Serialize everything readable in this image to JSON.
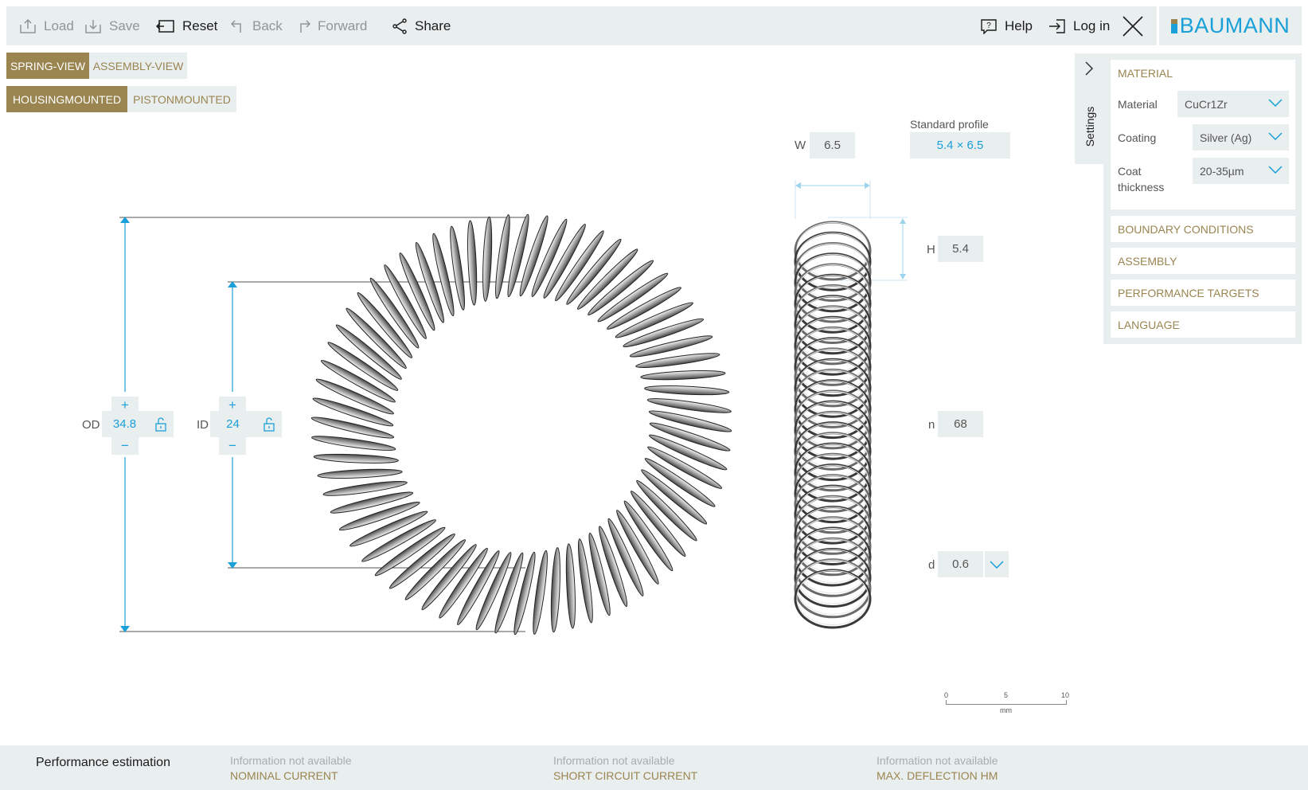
{
  "toolbar": {
    "load": "Load",
    "save": "Save",
    "reset": "Reset",
    "back": "Back",
    "forward": "Forward",
    "share": "Share",
    "help": "Help",
    "login": "Log in"
  },
  "brand": {
    "name": "BAUMANN",
    "color": "#1aa0d8"
  },
  "view_tabs": [
    "SPRING-VIEW",
    "ASSEMBLY-VIEW"
  ],
  "mount_tabs": [
    "HOUSINGMOUNTED",
    "PISTONMOUNTED"
  ],
  "dimensions": {
    "od": {
      "label": "OD",
      "value": "34.8"
    },
    "id": {
      "label": "ID",
      "value": "24"
    },
    "w": {
      "label": "W",
      "value": "6.5"
    },
    "h": {
      "label": "H",
      "value": "5.4"
    },
    "n": {
      "label": "n",
      "value": "68"
    },
    "d": {
      "label": "d",
      "value": "0.6"
    },
    "standard_profile": {
      "label": "Standard profile",
      "value": "5.4 × 6.5"
    },
    "plus": "+",
    "minus": "−"
  },
  "settings": {
    "tab_label": "Settings",
    "material_section": "MATERIAL",
    "material_label": "Material",
    "material_value": "CuCr1Zr",
    "coating_label": "Coating",
    "coating_value": "Silver (Ag)",
    "coat_thickness_label_1": "Coat",
    "coat_thickness_label_2": "thickness",
    "coat_thickness_value": "20-35µm",
    "sections": [
      "BOUNDARY CONDITIONS",
      "ASSEMBLY",
      "PERFORMANCE TARGETS",
      "LANGUAGE"
    ]
  },
  "scale": {
    "ticks": [
      "0",
      "5",
      "10"
    ],
    "unit": "mm"
  },
  "performance": {
    "title": "Performance estimation",
    "items": [
      {
        "status": "Information not available",
        "name": "NOMINAL CURRENT"
      },
      {
        "status": "Information not available",
        "name": "SHORT CIRCUIT CURRENT"
      },
      {
        "status": "Information not available",
        "name": "MAX. DEFLECTION HM"
      }
    ]
  },
  "colors": {
    "accent_gold": "#9a8550",
    "accent_blue": "#1aa0d8",
    "panel_gray": "#e9eeef"
  }
}
